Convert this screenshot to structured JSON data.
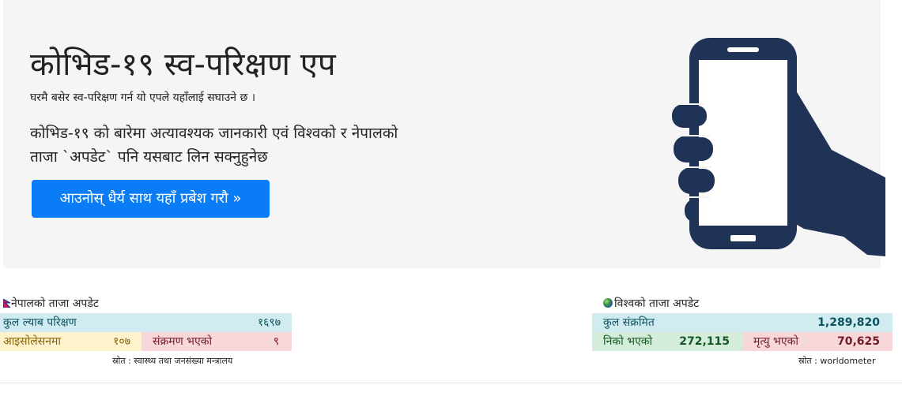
{
  "hero": {
    "title": "कोभिड-१९ स्व-परिक्षण एप",
    "subtitle": "घरमै बसेर स्व-परिक्षण गर्न यो एपले यहाँलाई सघाउने छ ।",
    "description_line1": "कोभिड-१९ को बारेमा अत्यावश्यक जानकारी एवं विश्वको र नेपालको",
    "description_line2": "ताजा `अपडेट` पनि यसबाट लिन सक्नुहुनेछ",
    "button_label": "आउनोस् धैर्य साथ यहाँ प्रबेश गरौ »",
    "illustration_icon": "hand-holding-phone-icon",
    "illustration_color": "#1f3356",
    "button_color": "#0a7cf5"
  },
  "nepal": {
    "flag_icon": "nepal-flag-icon",
    "title": "नेपालको ताजा अपडेट",
    "total_tests_label": "कुल ल्याब परिक्षण",
    "total_tests_value": "१६९७",
    "isolation_label": "आइसोलेसनमा",
    "isolation_value": "१०७",
    "infected_label": "संक्रमण भएको",
    "infected_value": "९",
    "source": "स्रोत : स्वास्थ्य तथा जनसंख्या मन्त्रालय"
  },
  "world": {
    "globe_icon": "globe-icon",
    "title": "विश्वको ताजा अपडेट",
    "total_infected_label": "कुल संक्रमित",
    "total_infected_value": "1,289,820",
    "recovered_label": "निको भएको",
    "recovered_value": "272,115",
    "deaths_label": "मृत्यु भएको",
    "deaths_value": "70,625",
    "source": "स्रोत : worldometer"
  }
}
